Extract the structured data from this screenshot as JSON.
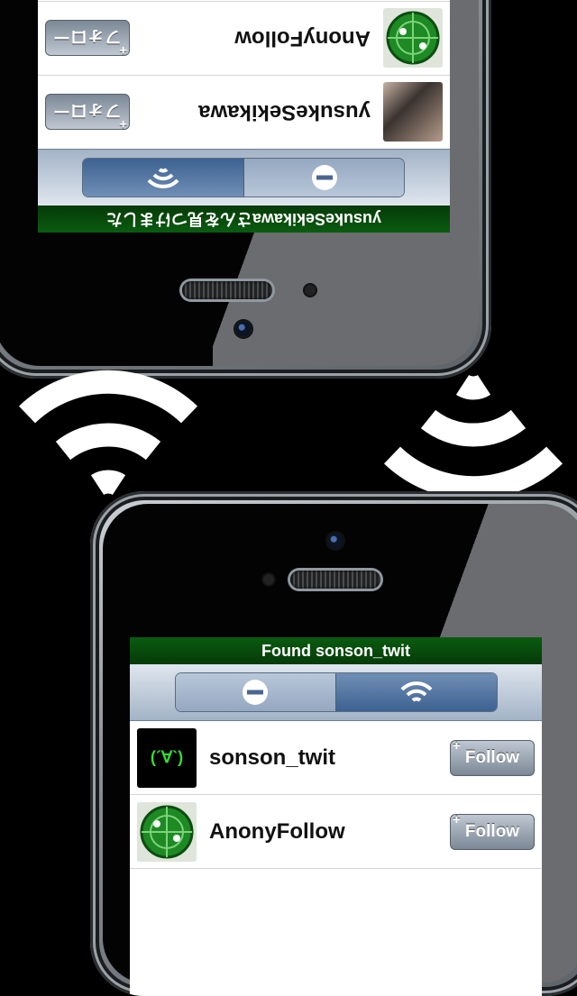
{
  "top_phone": {
    "status": "yusukeSekikawaさんを見つけました",
    "users": [
      {
        "name": "AnonyFollow",
        "button": "フォロー",
        "plus": "+"
      },
      {
        "name": "yusukeSekikawa",
        "button": "フォロー",
        "plus": "+"
      }
    ]
  },
  "bottom_phone": {
    "status": "Found sonson_twit",
    "users": [
      {
        "name": "sonson_twit",
        "avatar_text": "(´∀`)",
        "button": "Follow",
        "plus": "+"
      },
      {
        "name": "AnonyFollow",
        "button": "Follow",
        "plus": "+"
      }
    ]
  },
  "colors": {
    "status_green": "#0a5c10",
    "segment_selected": "#3d6191",
    "segment_unselected": "#94a8c1"
  },
  "icons": [
    "wifi-icon",
    "minus-icon",
    "radar-icon"
  ]
}
